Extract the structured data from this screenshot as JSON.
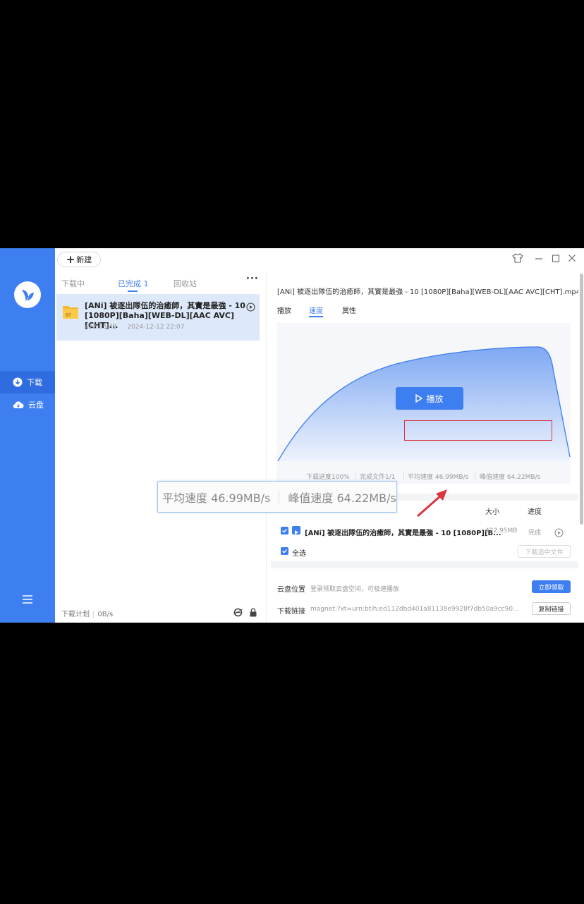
{
  "sidebar": {
    "items": [
      {
        "label": "下载",
        "icon": "download-icon",
        "active": true
      },
      {
        "label": "云盘",
        "icon": "cloud-icon",
        "active": false
      }
    ],
    "menu_icon": "menu-icon"
  },
  "topbar": {
    "new_label": "新建",
    "controls": [
      "shirt-icon",
      "minimize-icon",
      "maximize-icon",
      "close-icon"
    ]
  },
  "list": {
    "tabs": [
      {
        "label": "下载中"
      },
      {
        "label": "已完成 1",
        "active": true
      },
      {
        "label": "回收站"
      }
    ],
    "more": "···",
    "items": [
      {
        "badge": "BT",
        "title": "[ANi] 被逐出隊伍的治癒師，其實是最強 - 10 [1080P][Baha][WEB-DL][AAC AVC][CHT]...",
        "size": "422.95MB",
        "date": "2024-12-12 22:07"
      }
    ],
    "footer": {
      "plan_label": "下载计划",
      "speed": "0B/s"
    }
  },
  "detail": {
    "file_title": "[ANi] 被逐出隊伍的治癒師，其實是最強 - 10 [1080P][Baha][WEB-DL][AAC AVC][CHT].mp4",
    "tabs": [
      {
        "label": "播放"
      },
      {
        "label": "速度",
        "active": true
      },
      {
        "label": "属性"
      }
    ],
    "play_label": "播放",
    "stats": {
      "progress": "下载进度100%",
      "files": "完成文件1/1",
      "avg": "平均速度 46.99MB/s",
      "peak": "峰值速度 64.22MB/s"
    },
    "files_table": {
      "headers": {
        "size": "大小",
        "progress": "进度"
      },
      "rows": [
        {
          "name": "[ANi] 被逐出隊伍的治癒師，其實是最強 - 10 [1080P][B...",
          "size": "422.95MB",
          "status": "完成"
        }
      ],
      "select_all": "全选",
      "download_selected": "下载选中文件"
    },
    "cloud": {
      "location_label": "云盘位置",
      "location_value": "登录领取云盘空间，可极速播放",
      "claim_button": "立即领取",
      "link_label": "下载链接",
      "link_value": "magnet:?xt=urn:btih:ed112dbd401a81138e9928f7db50a9cc90...",
      "copy_button": "复制链接"
    }
  },
  "callout": {
    "avg": "平均速度 46.99MB/s",
    "peak": "峰值速度 64.22MB/s"
  },
  "colors": {
    "accent": "#3d7ef0",
    "highlight_box": "#d9363e"
  }
}
